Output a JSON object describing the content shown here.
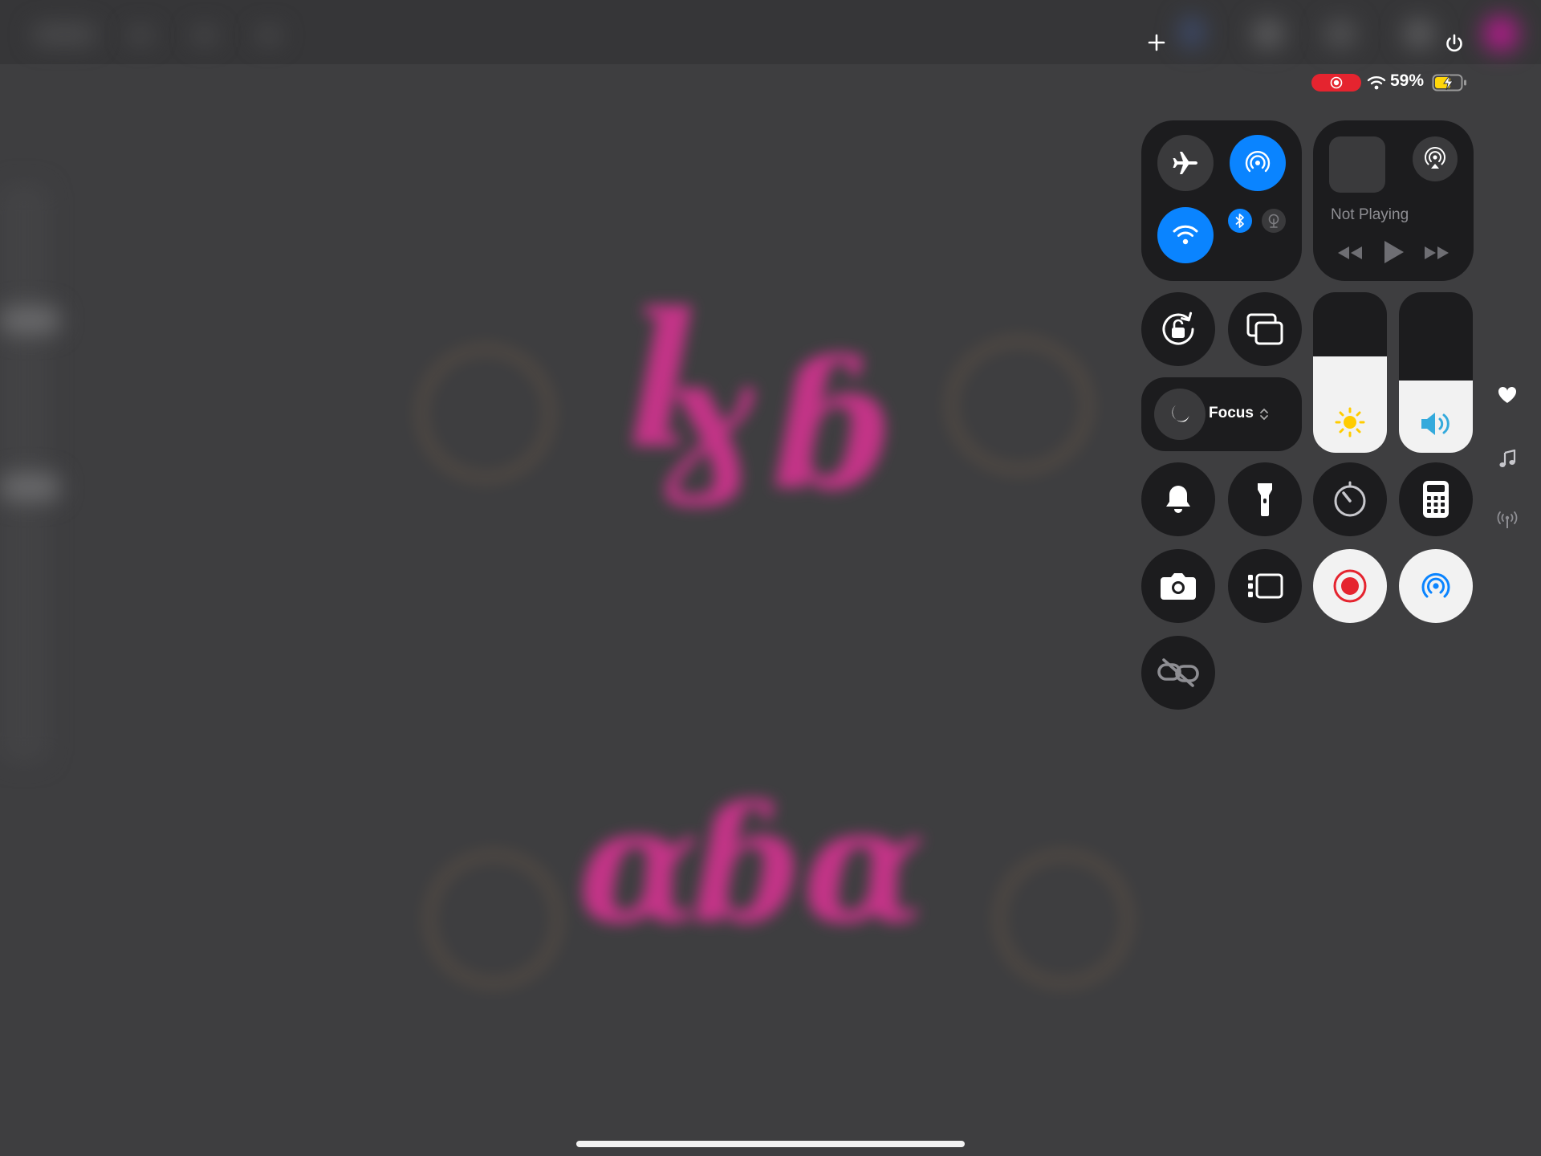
{
  "status_bar": {
    "battery_percent": "59%",
    "recording": true,
    "add_icon": "plus-icon",
    "power_icon": "power-icon"
  },
  "control_center": {
    "connectivity": {
      "airplane_mode": false,
      "airdrop": true,
      "wifi": true,
      "bluetooth": true,
      "cellular": false
    },
    "now_playing": {
      "status": "Not Playing"
    },
    "focus": {
      "label": "Focus"
    },
    "brightness_level": 0.6,
    "volume_level": 0.45,
    "controls": [
      "screen-lock-rotation-icon",
      "screen-mirroring-icon",
      "bell-icon",
      "flashlight-icon",
      "timer-icon",
      "calculator-icon",
      "camera-icon",
      "stage-manager-icon",
      "screen-record-icon",
      "hearing-icon",
      "link-icon"
    ]
  },
  "side_icons": [
    "heart-icon",
    "music-note-icon",
    "antenna-icon"
  ],
  "colors": {
    "accent_blue": "#0a84ff",
    "record_red": "#e5242f",
    "tile_bg": "#1c1c1e",
    "art_pink": "#d2338f"
  }
}
